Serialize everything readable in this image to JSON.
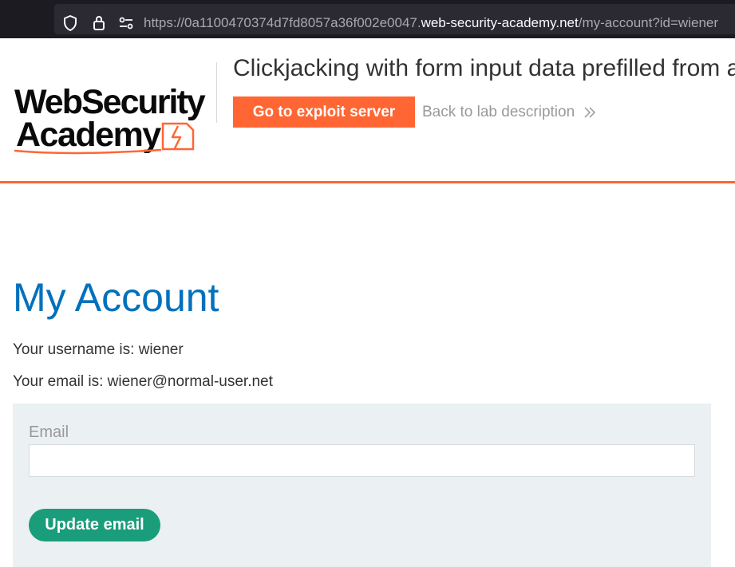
{
  "browser": {
    "url_prefix": "https://0a1100470374d7fd8057a36f002e0047.",
    "url_domain": "web-security-academy.net",
    "url_path": "/my-account?id=wiener",
    "icons": [
      "shield-icon",
      "lock-icon",
      "permissions-icon"
    ]
  },
  "header": {
    "logo_line1": "WebSecurity",
    "logo_line2": "Academy",
    "lab_title": "Clickjacking with form input data prefilled from a",
    "exploit_button": "Go to exploit server",
    "back_link": "Back to lab description",
    "accent_color": "#ff6633"
  },
  "main": {
    "title": "My Account",
    "username_line": "Your username is: wiener",
    "email_line": "Your email is: wiener@normal-user.net",
    "form": {
      "email_label": "Email",
      "email_value": "",
      "submit_label": "Update email"
    }
  }
}
